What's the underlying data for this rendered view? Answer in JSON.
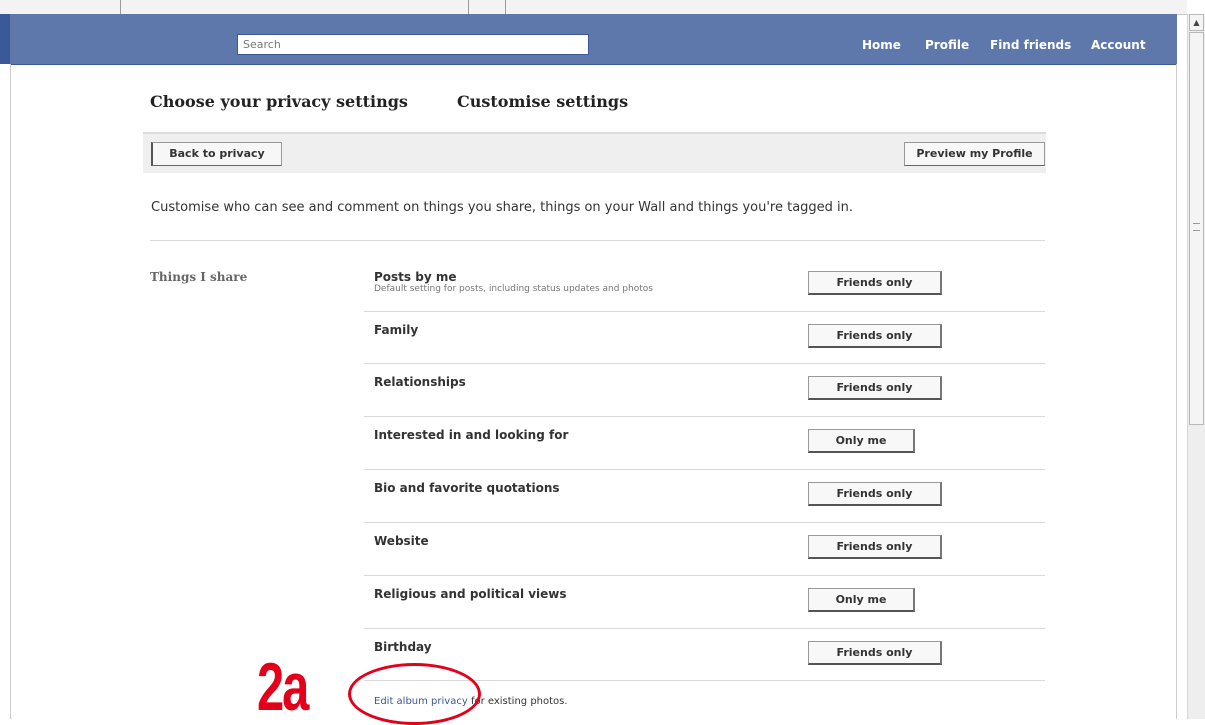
{
  "header": {
    "search_placeholder": "Search",
    "nav": [
      "Home",
      "Profile",
      "Find friends",
      "Account"
    ]
  },
  "page": {
    "title_left": "Choose your privacy settings",
    "title_right": "Customise settings",
    "back_button": "Back to privacy",
    "preview_button": "Preview my Profile",
    "description": "Customise who can see and comment on things you share, things on your Wall and things you're tagged in."
  },
  "section": {
    "label": "Things I share",
    "rows": [
      {
        "label": "Posts by me",
        "sub": "Default setting for posts, including status updates and photos",
        "value": "Friends only"
      },
      {
        "label": "Family",
        "value": "Friends only"
      },
      {
        "label": "Relationships",
        "value": "Friends only"
      },
      {
        "label": "Interested in and looking for",
        "value": "Only me"
      },
      {
        "label": "Bio and favorite quotations",
        "value": "Friends only"
      },
      {
        "label": "Website",
        "value": "Friends only"
      },
      {
        "label": "Religious and political views",
        "value": "Only me"
      },
      {
        "label": "Birthday",
        "value": "Friends only"
      }
    ]
  },
  "footer": {
    "link": "Edit album privacy",
    "rest": " for existing photos."
  },
  "annotation": {
    "label": "2a",
    "color": "#e3001b"
  },
  "colors": {
    "brand": "#3b5998",
    "bar": "#5f78ac"
  }
}
